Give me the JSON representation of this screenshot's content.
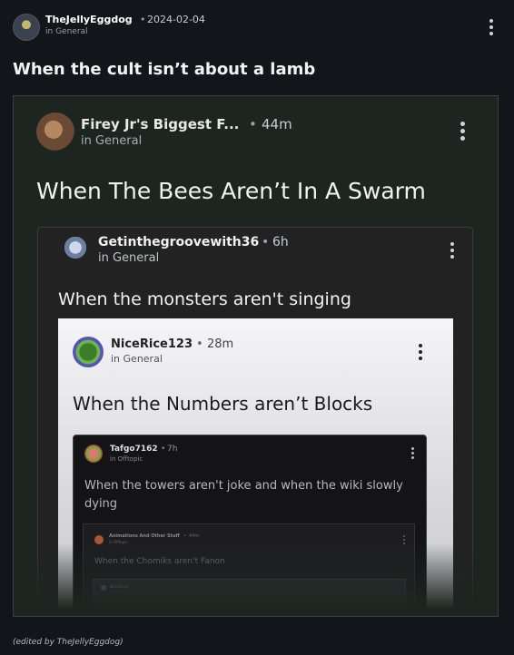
{
  "post": {
    "author": "TheJellyEggdog",
    "separator": "•",
    "date": "2024-02-04",
    "community": "in General",
    "title": "When the cult isn’t about a lamb",
    "edited_note": "(edited by TheJellyEggdog)"
  },
  "quote1": {
    "author": "Firey Jr's Biggest F...",
    "separator": "•",
    "time": "44m",
    "community": "in General",
    "title": "When The Bees Aren’t In A Swarm"
  },
  "quote2": {
    "author": "Getinthegroovewith36",
    "separator": "•",
    "time": "6h",
    "community": "in General",
    "title": "When the monsters aren't singing"
  },
  "quote3": {
    "author": "NiceRice123",
    "separator": "•",
    "time": "28m",
    "community": "in General",
    "title": "When the Numbers aren’t Blocks"
  },
  "quote4": {
    "author": "Tafgo7162",
    "separator": "•",
    "time": "7h",
    "community": "in Offtopic",
    "title": "When the towers aren't joke and when the wiki slowly dying"
  },
  "quote5": {
    "author": "Animations And Other Stuff",
    "separator": "•",
    "time": "44m",
    "community": "in Offtopic",
    "title": "When the Chomiks aren't Fanon"
  },
  "quote6": {
    "author": "ALLStars",
    "community": "in General"
  },
  "icons": {
    "more": "kebab-menu-icon"
  }
}
